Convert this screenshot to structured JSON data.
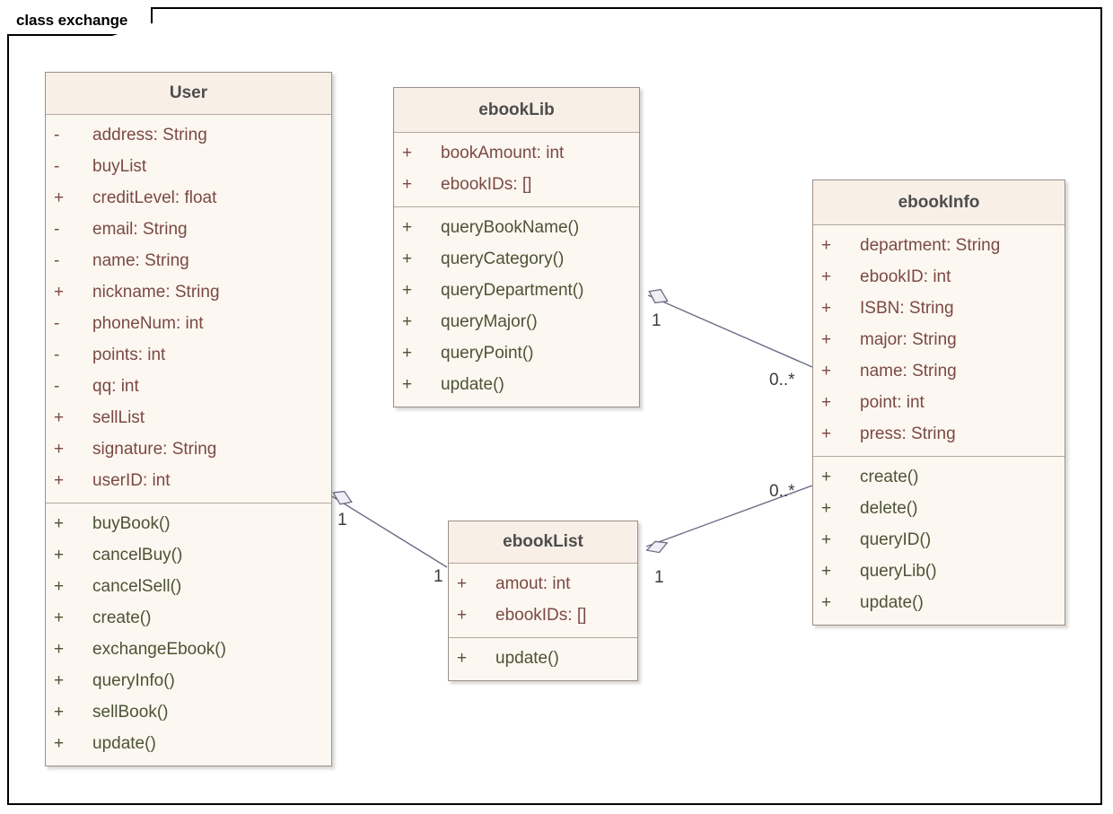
{
  "frame": {
    "label": "class exchange"
  },
  "classes": [
    {
      "id": "user",
      "name": "User",
      "attributes": [
        {
          "visibility": "-",
          "text": "address: String"
        },
        {
          "visibility": "-",
          "text": "buyList"
        },
        {
          "visibility": "+",
          "text": "creditLevel: float"
        },
        {
          "visibility": "-",
          "text": "email: String"
        },
        {
          "visibility": "-",
          "text": "name: String"
        },
        {
          "visibility": "+",
          "text": "nickname: String"
        },
        {
          "visibility": "-",
          "text": "phoneNum: int"
        },
        {
          "visibility": "-",
          "text": "points: int"
        },
        {
          "visibility": "-",
          "text": "qq: int"
        },
        {
          "visibility": "+",
          "text": "sellList"
        },
        {
          "visibility": "+",
          "text": "signature: String"
        },
        {
          "visibility": "+",
          "text": "userID: int"
        }
      ],
      "methods": [
        {
          "visibility": "+",
          "text": "buyBook()"
        },
        {
          "visibility": "+",
          "text": "cancelBuy()"
        },
        {
          "visibility": "+",
          "text": "cancelSell()"
        },
        {
          "visibility": "+",
          "text": "create()"
        },
        {
          "visibility": "+",
          "text": "exchangeEbook()"
        },
        {
          "visibility": "+",
          "text": "queryInfo()"
        },
        {
          "visibility": "+",
          "text": "sellBook()"
        },
        {
          "visibility": "+",
          "text": "update()"
        }
      ]
    },
    {
      "id": "ebooklib",
      "name": "ebookLib",
      "attributes": [
        {
          "visibility": "+",
          "text": "bookAmount: int"
        },
        {
          "visibility": "+",
          "text": "ebookIDs: []"
        }
      ],
      "methods": [
        {
          "visibility": "+",
          "text": "queryBookName()"
        },
        {
          "visibility": "+",
          "text": "queryCategory()"
        },
        {
          "visibility": "+",
          "text": "queryDepartment()"
        },
        {
          "visibility": "+",
          "text": "queryMajor()"
        },
        {
          "visibility": "+",
          "text": "queryPoint()"
        },
        {
          "visibility": "+",
          "text": "update()"
        }
      ]
    },
    {
      "id": "ebookinfo",
      "name": "ebookInfo",
      "attributes": [
        {
          "visibility": "+",
          "text": "department: String"
        },
        {
          "visibility": "+",
          "text": "ebookID: int"
        },
        {
          "visibility": "+",
          "text": "ISBN: String"
        },
        {
          "visibility": "+",
          "text": "major: String"
        },
        {
          "visibility": "+",
          "text": "name: String"
        },
        {
          "visibility": "+",
          "text": "point: int"
        },
        {
          "visibility": "+",
          "text": "press: String"
        }
      ],
      "methods": [
        {
          "visibility": "+",
          "text": "create()"
        },
        {
          "visibility": "+",
          "text": "delete()"
        },
        {
          "visibility": "+",
          "text": "queryID()"
        },
        {
          "visibility": "+",
          "text": "queryLib()"
        },
        {
          "visibility": "+",
          "text": "update()"
        }
      ]
    },
    {
      "id": "ebooklist",
      "name": "ebookList",
      "attributes": [
        {
          "visibility": "+",
          "text": "amout: int"
        },
        {
          "visibility": "+",
          "text": "ebookIDs: []"
        }
      ],
      "methods": [
        {
          "visibility": "+",
          "text": "update()"
        }
      ]
    }
  ],
  "associations": [
    {
      "id": "lib-info",
      "from": "ebookLib",
      "to": "ebookInfo",
      "from_multiplicity": "1",
      "to_multiplicity": "0..*",
      "kind": "aggregation"
    },
    {
      "id": "user-list",
      "from": "User",
      "to": "ebookList",
      "from_multiplicity": "1",
      "to_multiplicity": "1",
      "kind": "aggregation"
    },
    {
      "id": "list-info",
      "from": "ebookList",
      "to": "ebookInfo",
      "from_multiplicity": "1",
      "to_multiplicity": "0..*",
      "kind": "aggregation"
    }
  ],
  "colors": {
    "class_fill": "#fdf7f1",
    "class_header_fill": "#f8efe6",
    "class_border": "#9b8f8a",
    "attribute_text": "#7a4a43",
    "method_text": "#4c5334",
    "class_name_text": "#4d4d4d",
    "connector": "#6b6b85",
    "frame_border": "#000000"
  }
}
